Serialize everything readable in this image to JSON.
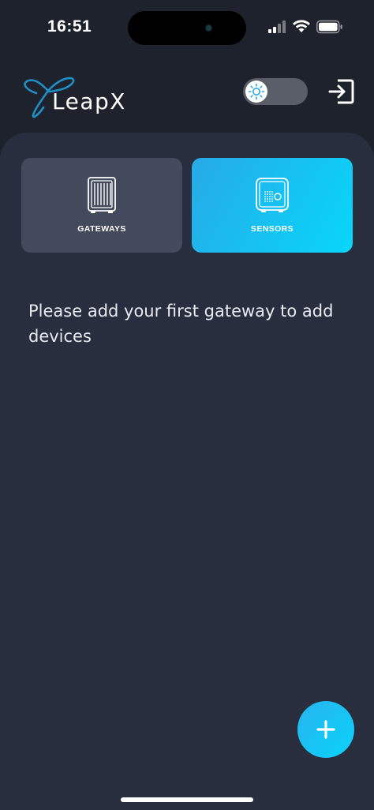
{
  "status_bar": {
    "time": "16:51",
    "icons": [
      "cellular-signal-icon",
      "wifi-icon",
      "battery-icon"
    ]
  },
  "header": {
    "logo_text": "LeapX",
    "theme_toggle": {
      "icon": "sun-icon",
      "state": "light"
    },
    "logout_icon": "logout-icon"
  },
  "tabs": [
    {
      "label": "GATEWAYS",
      "icon": "gateway-icon",
      "selected": false
    },
    {
      "label": "SENSORS",
      "icon": "sensor-icon",
      "selected": true
    }
  ],
  "main": {
    "empty_message": "Please add your first gateway to add devices"
  },
  "fab": {
    "icon": "plus-icon"
  },
  "colors": {
    "background": "#1e222c",
    "panel": "#292e3f",
    "tab_inactive": "#434a5b",
    "accent_start": "#27aae6",
    "accent_end": "#08d6fb",
    "logo_blue": "#1f8fc4"
  }
}
